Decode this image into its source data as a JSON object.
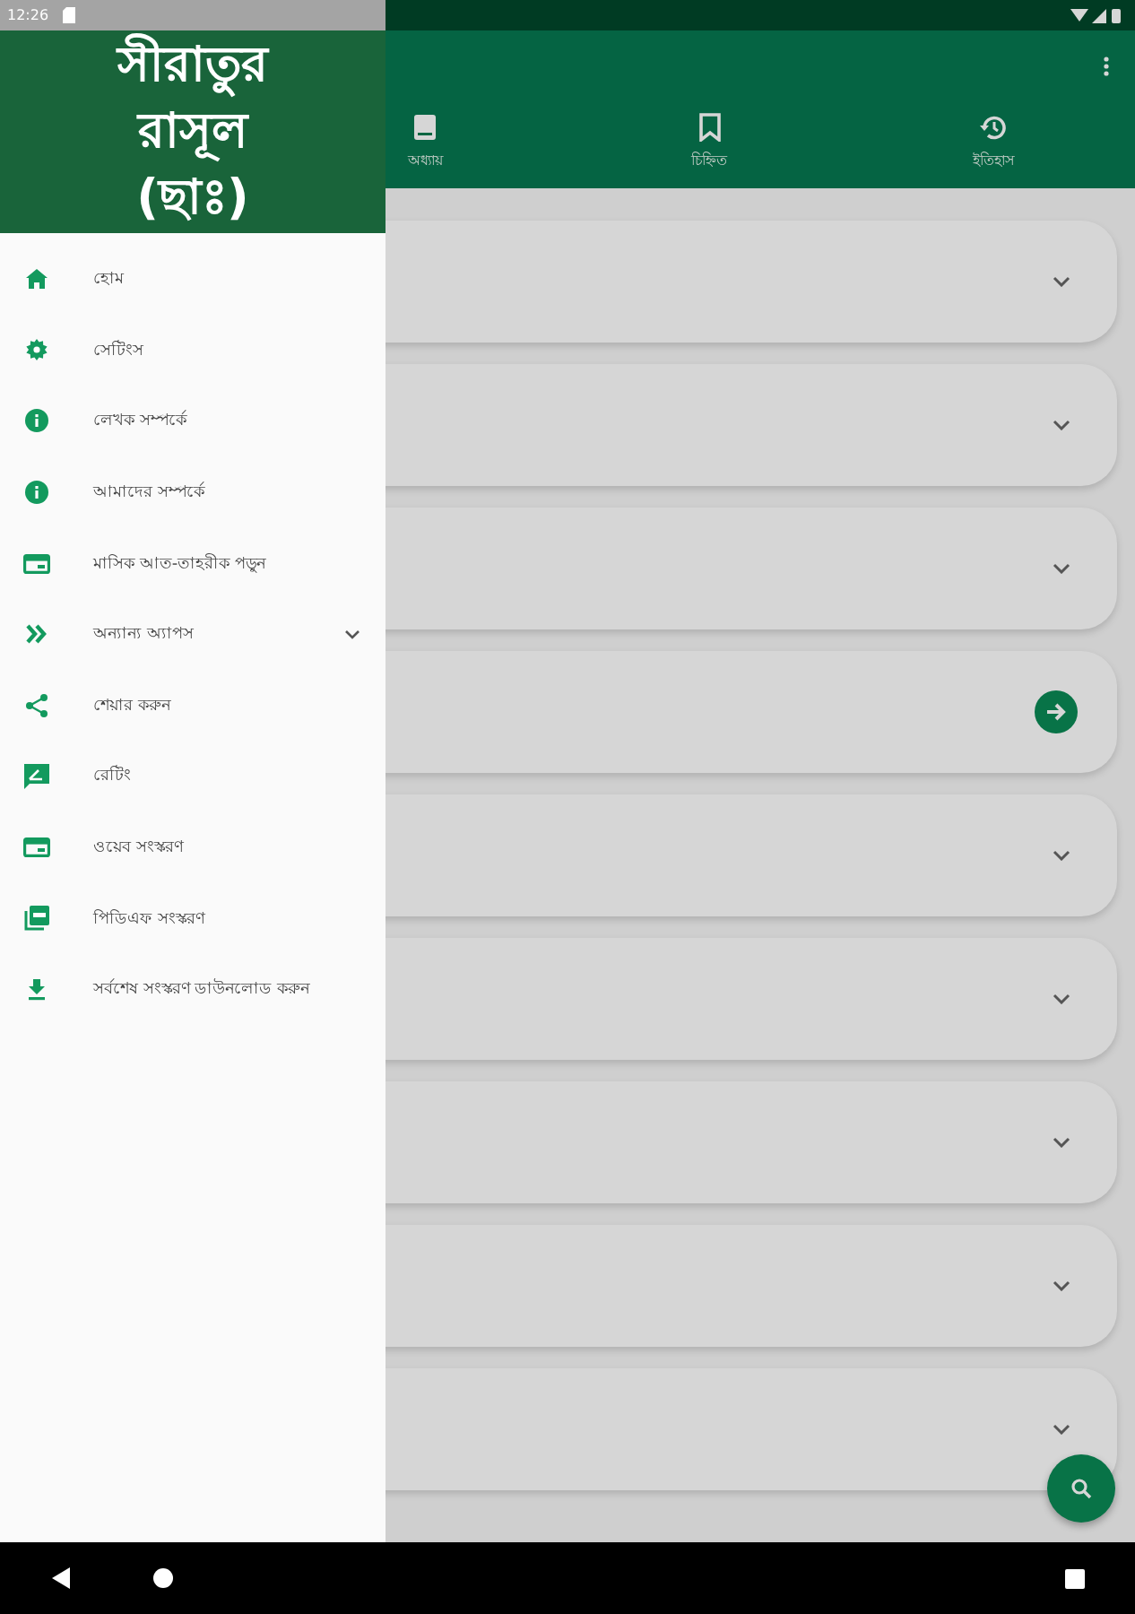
{
  "status_bar": {
    "time": "12:26"
  },
  "drawer": {
    "title": "সীরাতুর রাসূল (ছাঃ)",
    "items": [
      {
        "kind": "home",
        "label": "হোম"
      },
      {
        "kind": "gear",
        "label": "সেটিংস"
      },
      {
        "kind": "info",
        "label": "লেখক সম্পর্কে"
      },
      {
        "kind": "info",
        "label": "আমাদের সম্পর্কে"
      },
      {
        "kind": "web",
        "label": "মাসিক আত-তাহরীক পড়ুন"
      },
      {
        "kind": "chevrons",
        "label": "অন্যান্য অ্যাপস",
        "expanded": false
      },
      {
        "kind": "share",
        "label": "শেয়ার করুন"
      },
      {
        "kind": "rate",
        "label": "রেটিং"
      },
      {
        "kind": "web",
        "label": "ওয়েব সংস্করণ"
      },
      {
        "kind": "pdf",
        "label": "পিডিএফ সংস্করণ"
      },
      {
        "kind": "download",
        "label": "সর্বশেষ সংস্করণ ডাউনলোড করুন"
      }
    ]
  },
  "tabs": [
    {
      "kind": "book",
      "label": "অধ্যায়"
    },
    {
      "kind": "bookmark",
      "label": "চিহ্নিত"
    },
    {
      "kind": "history",
      "label": "ইতিহাস"
    }
  ],
  "cards": [
    {
      "kind": "expand"
    },
    {
      "kind": "expand"
    },
    {
      "kind": "expand"
    },
    {
      "kind": "open"
    },
    {
      "kind": "expand"
    },
    {
      "kind": "expand"
    },
    {
      "kind": "expand"
    },
    {
      "kind": "expand"
    },
    {
      "kind": "expand"
    }
  ]
}
